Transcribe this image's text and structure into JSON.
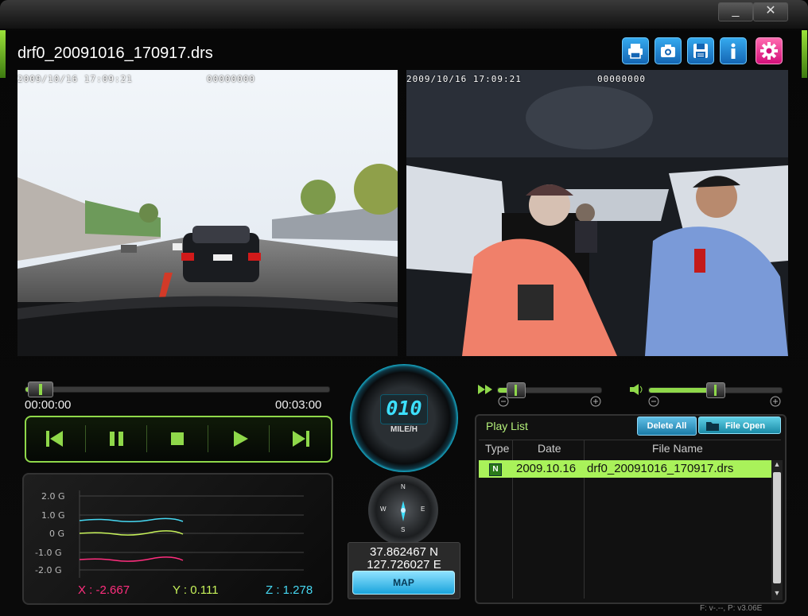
{
  "window": {
    "minimize": "_",
    "close": "✕"
  },
  "file": {
    "title": "drf0_20091016_170917.drs"
  },
  "toolbar": {
    "icons": [
      "print-icon",
      "camera-icon",
      "save-icon",
      "info-icon",
      "settings-icon"
    ]
  },
  "video": {
    "front": {
      "timestamp": "2009/10/16  17:09:21",
      "counter": "00000000"
    },
    "rear": {
      "timestamp": "2009/10/16  17:09:21",
      "counter": "00000000"
    }
  },
  "playback": {
    "current_time": "00:00:00",
    "total_time": "00:03:00",
    "progress": 0.05
  },
  "gsensor": {
    "y_labels": [
      "2.0 G",
      "1.0 G",
      "0 G",
      "-1.0 G",
      "-2.0 G"
    ],
    "x_readout": "X : -2.667",
    "y_readout": "Y : 0.111",
    "z_readout": "Z : 1.278",
    "colors": {
      "x": "#ff2e7e",
      "y": "#c7f25a",
      "z": "#46d8f2"
    }
  },
  "speed": {
    "value": "010",
    "unit": "MILE/H"
  },
  "compass": {
    "n": "N",
    "e": "E",
    "s": "S",
    "w": "W"
  },
  "gps": {
    "lat": "37.862467 N",
    "lon": "127.726027 E",
    "map_label": "MAP"
  },
  "speed_slider": {
    "level": 0.18
  },
  "volume_slider": {
    "level": 0.5
  },
  "playlist": {
    "title": "Play List",
    "delete_all": "Delete All",
    "file_open": "File Open",
    "columns": [
      "Type",
      "Date",
      "File Name"
    ],
    "rows": [
      {
        "type": "N",
        "date": "2009.10.16",
        "name": "drf0_20091016_170917.drs"
      }
    ]
  },
  "footer": {
    "version": "F: v-.--, P: v3.06E"
  },
  "accent": "#8fd84a"
}
